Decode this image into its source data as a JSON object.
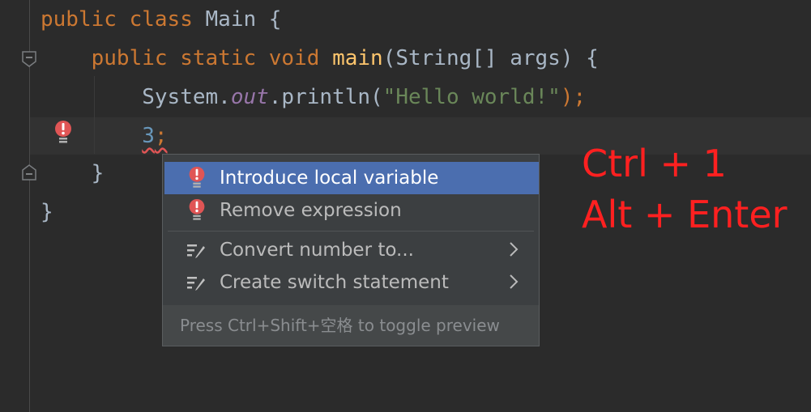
{
  "code": {
    "line1": {
      "kw1": "public",
      "kw2": "class",
      "name": "Main",
      "brace": "{"
    },
    "line2": {
      "kw1": "public",
      "kw2": "static",
      "kw3": "void",
      "fn": "main",
      "params": "(String[] args) {"
    },
    "line3": {
      "obj": "System.",
      "field": "out",
      "call": ".println(",
      "str": "\"Hello world!\"",
      "end": ");"
    },
    "line4": {
      "num": "3",
      "semi": ";"
    },
    "line5": "}",
    "line6": "}"
  },
  "popup": {
    "items": [
      {
        "label": "Introduce local variable",
        "icon": "error-bulb-icon",
        "selected": true
      },
      {
        "label": "Remove expression",
        "icon": "error-bulb-icon"
      },
      {
        "label": "Convert number to...",
        "icon": "edit-intention-icon",
        "submenu": true
      },
      {
        "label": "Create switch statement",
        "icon": "edit-intention-icon",
        "submenu": true
      }
    ],
    "footer": "Press Ctrl+Shift+空格 to toggle preview"
  },
  "annotation": {
    "line1": "Ctrl + 1",
    "line2": "Alt + Enter",
    "color": "#ff2020"
  },
  "colors": {
    "background": "#2b2b2b",
    "keyword": "#cc7832",
    "function": "#ffc66d",
    "string": "#6a8759",
    "field": "#9876aa",
    "number": "#6897bb",
    "selection": "#4b6eaf"
  }
}
